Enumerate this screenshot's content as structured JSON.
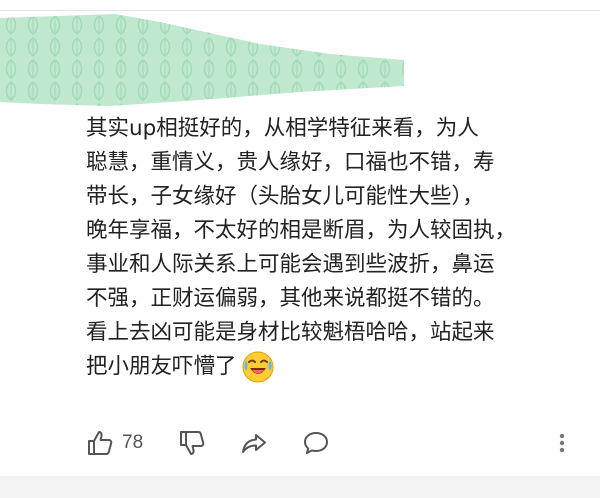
{
  "comment": {
    "lines": [
      "其实up相挺好的，从相学特征来看，为人",
      "聪慧，重情义，贵人缘好，口福也不错，寿",
      "带长，子女缘好（头胎女儿可能性大些），",
      "晚年享福，不太好的相是断眉，为人较固执，",
      "事业和人际关系上可能会遇到些波折，鼻运",
      "不强，正财运偏弱，其他来说都挺不错的。",
      "看上去凶可能是身材比较魁梧哈哈，站起来",
      "把小朋友吓懵了"
    ],
    "trailing_emoji": "laughing-crying-emoji"
  },
  "actions": {
    "like_icon": "thumbs-up-icon",
    "like_count": "78",
    "dislike_icon": "thumbs-down-icon",
    "share_icon": "share-arrow-icon",
    "reply_icon": "comment-bubble-icon",
    "more_icon": "more-vertical-icon"
  },
  "colors": {
    "text": "#222222",
    "icon": "#555555",
    "redaction_fill": "#bfe8cf",
    "redaction_pattern": "#9fd9b4"
  }
}
